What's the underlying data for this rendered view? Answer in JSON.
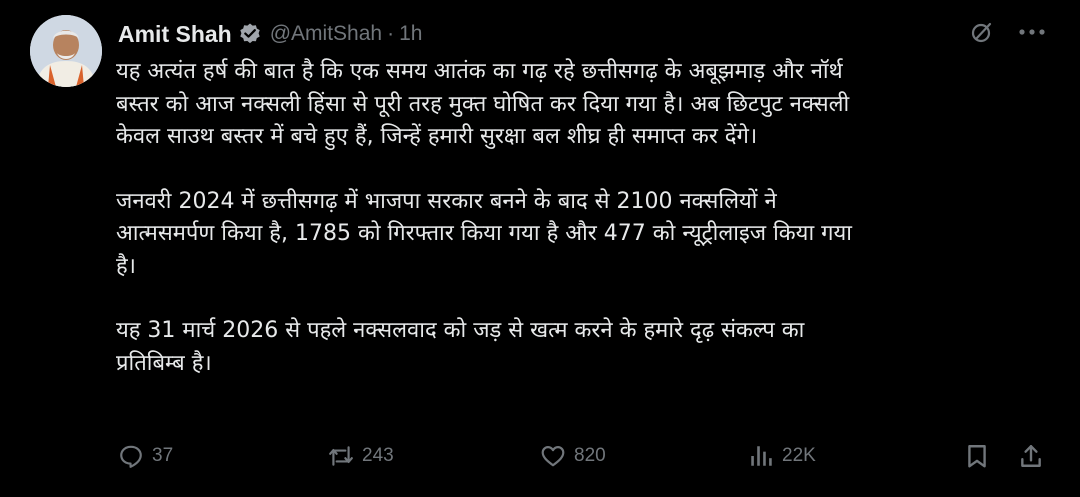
{
  "author": {
    "name": "Amit Shah",
    "handle": "@AmitShah",
    "separator": "·",
    "time": "1h"
  },
  "tweet": {
    "paragraphs": [
      "यह अत्यंत हर्ष की बात है कि एक समय आतंक का गढ़ रहे छत्तीसगढ़ के अबूझमाड़ और नॉर्थ\nबस्तर को आज नक्सली हिंसा से पूरी तरह मुक्त घोषित कर दिया गया है। अब छिटपुट नक्सली\nकेवल साउथ बस्तर में बचे हुए हैं, जिन्हें हमारी सुरक्षा बल शीघ्र ही समाप्त कर देंगे।",
      "जनवरी 2024 में छत्तीसगढ़ में भाजपा सरकार बनने के बाद से 2100 नक्सलियों ने\nआत्मसमर्पण किया है, 1785 को गिरफ्तार किया गया है और 477 को न्यूट्रीलाइज किया गया\nहै।",
      "यह 31 मार्च 2026 से पहले नक्सलवाद को जड़ से खत्म करने के हमारे दृढ़ संकल्प का\nप्रतिबिम्ब है।"
    ]
  },
  "actions": {
    "replies": "37",
    "reposts": "243",
    "likes": "820",
    "views": "22K"
  },
  "icons": {
    "verified": "verified-badge-icon",
    "grok": "grok-icon",
    "more": "more-icon",
    "reply": "reply-icon",
    "repost": "repost-icon",
    "like": "like-icon",
    "views": "views-icon",
    "bookmark": "bookmark-icon",
    "share": "share-icon"
  },
  "colors": {
    "background": "#000000",
    "text": "#e7e9ea",
    "muted": "#71767b",
    "verified": "#a0a5ab"
  }
}
